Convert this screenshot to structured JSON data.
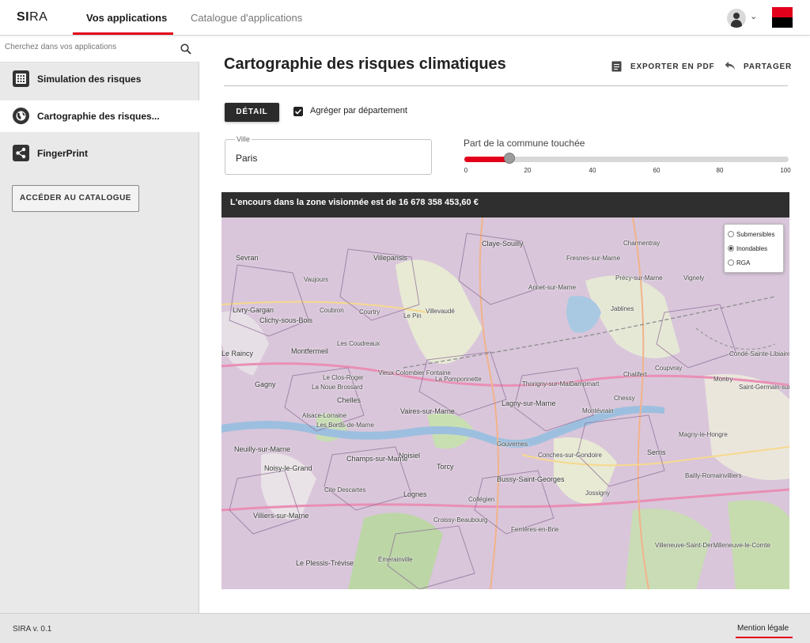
{
  "header": {
    "brand_bold": "SI",
    "brand_rest": "RA",
    "tabs": [
      {
        "label": "Vos applications",
        "active": true
      },
      {
        "label": "Catalogue d'applications",
        "active": false
      }
    ],
    "colors": {
      "accent": "#e2001a",
      "dark": "#000000"
    }
  },
  "sidebar": {
    "search_placeholder": "Cherchez dans vos applications",
    "items": [
      {
        "label": "Simulation des risques",
        "icon": "building-grid-icon",
        "active": false
      },
      {
        "label": "Cartographie des risques...",
        "icon": "globe-icon",
        "active": true
      },
      {
        "label": "FingerPrint",
        "icon": "share-icon",
        "active": false
      }
    ],
    "catalog_button": "ACCÉDER AU CATALOGUE"
  },
  "main": {
    "title": "Cartographie des risques climatiques",
    "actions": {
      "export": "EXPORTER EN PDF",
      "share": "PARTAGER"
    },
    "detail_button": "DÉTAIL",
    "aggregate_label": "Agréger par département",
    "aggregate_checked": true,
    "ville": {
      "label": "Ville",
      "value": "Paris"
    },
    "slider": {
      "label": "Part de la commune touchée",
      "value_percent": 14,
      "ticks": [
        "0",
        "20",
        "40",
        "60",
        "80",
        "100"
      ]
    },
    "banner": "L'encours dans la zone visionnée est de 16 678 358 453,60 €",
    "map": {
      "layers": [
        {
          "label": "Submersibles",
          "selected": false
        },
        {
          "label": "Inondables",
          "selected": true
        },
        {
          "label": "RGA",
          "selected": false
        }
      ],
      "places": [
        "Sevran",
        "Villeparisis",
        "Claye-Souilly",
        "Charmentray",
        "Vaujours",
        "Livry-Gargan",
        "Clichy-sous-Bois",
        "Coubron",
        "Courtry",
        "Le Pin",
        "Villevaudé",
        "Annet-sur-Marne",
        "Jablines",
        "Fresnes-sur-Marne",
        "Précy-sur-Marne",
        "Vignely",
        "Montfermeil",
        "Les Coudreaux",
        "Le Raincy",
        "Gagny",
        "Le Clos-Roger",
        "La Noue Brossard",
        "Vieux Colombier Fontaine",
        "La Pomponnette",
        "Thorigny-sur-Marne",
        "Dampmart",
        "Chalifert",
        "Coupvray",
        "Chelles",
        "Vaires-sur-Marne",
        "Lagny-sur-Marne",
        "Montévrain",
        "Chessy",
        "Alsace-Lorraine",
        "Les Bords-de-Marne",
        "Neuilly-sur-Marne",
        "Champs-sur-Marne",
        "Noisiel",
        "Torcy",
        "Conches-sur-Gondoire",
        "Serris",
        "Noisy-le-Grand",
        "Cite Descartes",
        "Bussy-Saint-Georges",
        "Lognes",
        "Collégien",
        "Croissy-Beaubourg",
        "Villiers-sur-Marne",
        "Ferrières-en-Brie",
        "Le Plessis-Trévise",
        "Villeneuve-Saint-Denis",
        "Villeneuve-le-Comte",
        "Magny-le-Hongre",
        "Bailly-Romainvilliers",
        "Montry",
        "Condé-Sainte-Libiaire",
        "Saint-Germain-sur-Morin",
        "Émerainville",
        "Gouvernes",
        "Jossigny"
      ]
    }
  },
  "footer": {
    "version": "SIRA v. 0.1",
    "legal": "Mention légale"
  }
}
